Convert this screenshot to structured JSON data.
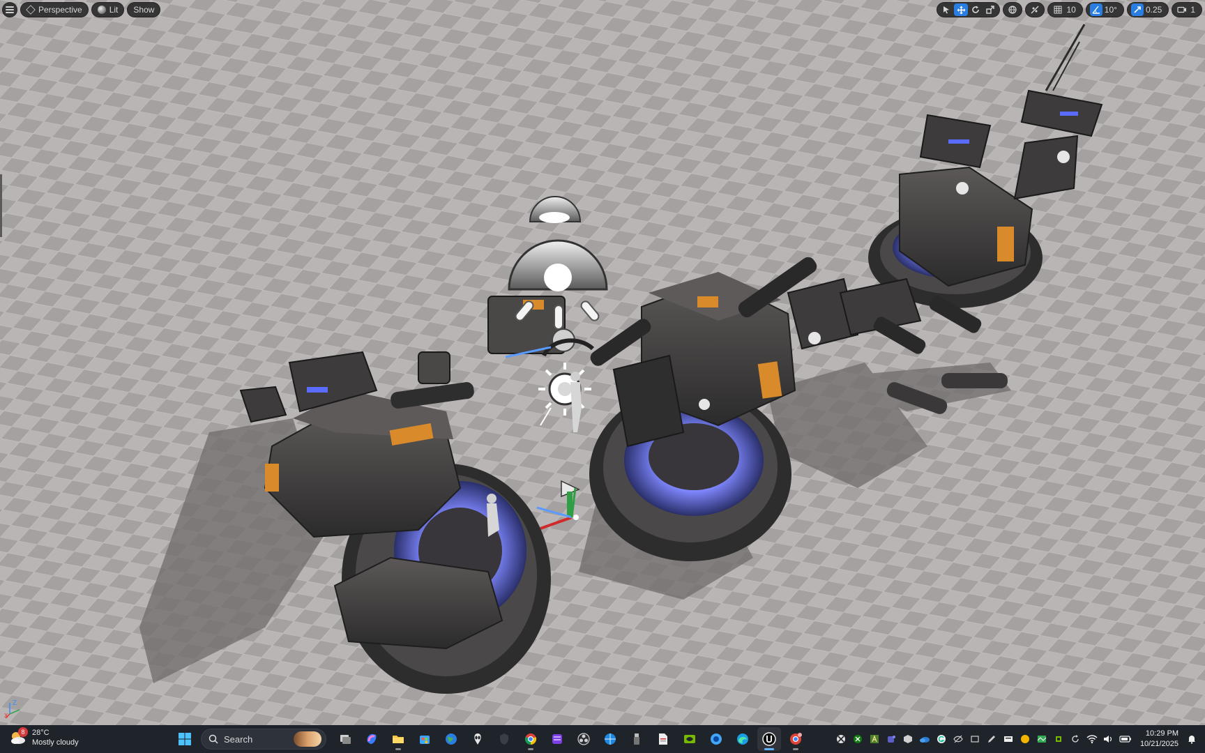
{
  "viewport": {
    "toolbar_left": {
      "menu_icon": "hamburger-icon",
      "view_mode": "Perspective",
      "lit_mode": "Lit",
      "show_label": "Show"
    },
    "toolbar_right": {
      "tools": [
        "select-icon",
        "translate-icon",
        "rotate-icon",
        "scale-icon"
      ],
      "active_tool": "translate-icon",
      "grid_snap": "10",
      "rotation_snap": "10°",
      "scale_snap": "0.25",
      "camera_speed": "1"
    },
    "axis_labels": {
      "z": "Z",
      "x": "X"
    }
  },
  "taskbar": {
    "weather": {
      "badge": "8",
      "temperature": "28°C",
      "condition": "Mostly cloudy"
    },
    "search_placeholder": "Search",
    "apps": [
      "windows-start-icon",
      "task-view-icon",
      "copilot-icon",
      "file-explorer-icon",
      "microsoft-store-icon",
      "earth-icon",
      "alienware-icon",
      "shield-app-icon",
      "chrome-icon",
      "purple-app-icon",
      "obs-icon",
      "globe-app-icon",
      "usb-icon",
      "document-icon",
      "nvidia-icon",
      "web-icon",
      "edge-icon",
      "unreal-engine-icon",
      "chrome-profile-icon"
    ],
    "active_app": "unreal-engine-icon",
    "tray_icons": [
      "xbox-icon",
      "xbox-green-icon",
      "font-icon",
      "teams-icon",
      "cube-tray-icon",
      "onedrive-icon",
      "grammarly-icon",
      "eye-off-icon",
      "wifi-sync-icon",
      "pen-icon",
      "ime-icon",
      "circle-tray-icon",
      "map-tray-icon",
      "chip-icon",
      "refresh-icon",
      "wifi-icon",
      "volume-icon",
      "battery-icon"
    ],
    "clock": {
      "time": "10:29 PM",
      "date": "10/21/2025"
    },
    "notification_icon": "notification-bell-icon"
  },
  "colors": {
    "floor_light": "#b9b6b5",
    "floor_dark": "#9f9c9b",
    "accent_blue": "#2a7de1",
    "glow_blue": "#6f7bff",
    "panel_orange": "#d98a2b",
    "metal_dark": "#3b3a3a"
  }
}
